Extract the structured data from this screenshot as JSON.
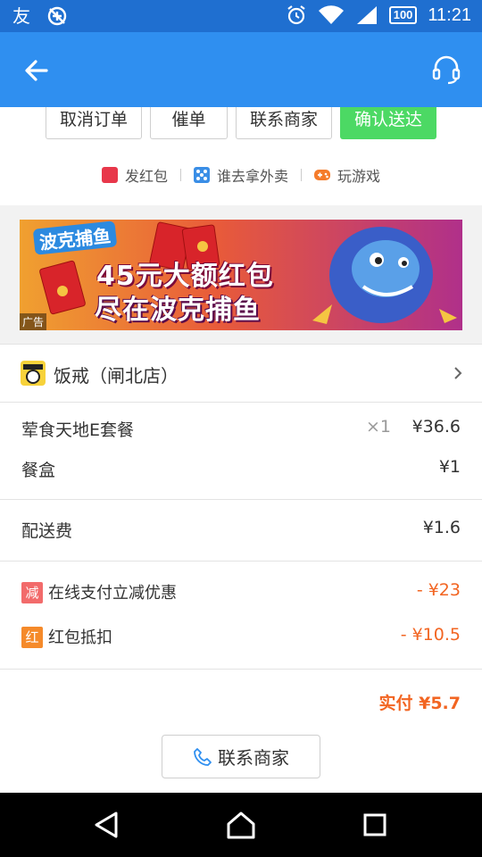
{
  "status_bar": {
    "time": "11:21",
    "battery": "100",
    "icons": [
      "notification-icon",
      "no-sync-icon",
      "alarm-icon",
      "wifi-icon",
      "signal-icon",
      "battery-icon"
    ]
  },
  "app_bar": {
    "back_icon": "arrow-left-icon",
    "support_icon": "headset-icon",
    "color": "#2f8ff0"
  },
  "order_actions": {
    "cancel": "取消订单",
    "urge": "催单",
    "contact_merchant": "联系商家",
    "confirm_delivery": "确认送达"
  },
  "extra_links": {
    "send_red_packet": "发红包",
    "who_picks_takeout": "谁去拿外卖",
    "play_game": "玩游戏"
  },
  "banner": {
    "headline": "45元大额红包",
    "subline": "尽在波克捕鱼",
    "brand": "波克捕鱼",
    "ad_label": "广告"
  },
  "shop": {
    "name": "饭戒（闸北店）"
  },
  "items": [
    {
      "name": "荤食天地E套餐",
      "qty": "×1",
      "price": "¥36.6"
    },
    {
      "name": "餐盒",
      "qty": "",
      "price": "¥1"
    }
  ],
  "delivery": {
    "label": "配送费",
    "price": "¥1.6"
  },
  "discounts": [
    {
      "tag": "减",
      "label": "在线支付立减优惠",
      "amount": "- ¥23",
      "tag_color": "#f26b6b"
    },
    {
      "tag": "红",
      "label": "红包抵扣",
      "amount": "- ¥10.5",
      "tag_color": "#f58a2a"
    }
  ],
  "total": "实付 ¥5.7",
  "contact_button": "联系商家",
  "colors": {
    "accent": "#2f8ff0",
    "confirm": "#4cd964",
    "discount": "#f26522"
  }
}
